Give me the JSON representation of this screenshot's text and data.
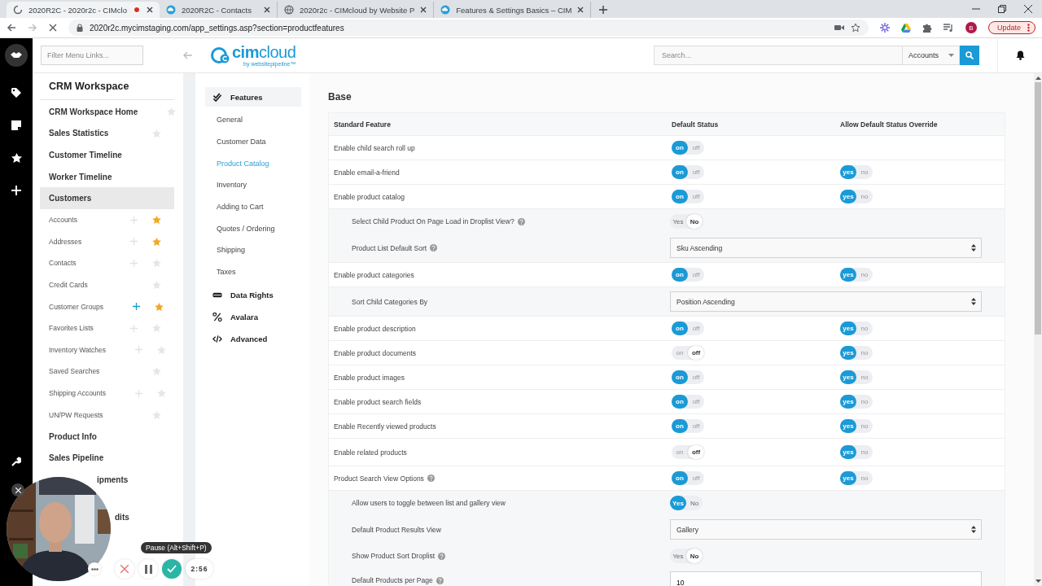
{
  "browser": {
    "tabs": [
      {
        "kind": "loading",
        "title": "2020R2C - 2020r2c - CIMclo",
        "recording": true,
        "selected": true
      },
      {
        "kind": "site",
        "title": "2020R2C - Contacts",
        "recording": false,
        "selected": false
      },
      {
        "kind": "globe",
        "title": "2020r2c - CIMcloud by Website P",
        "recording": false,
        "selected": false
      },
      {
        "kind": "site",
        "title": "Features & Settings Basics – CIM",
        "recording": false,
        "selected": false
      }
    ],
    "url": "2020r2c.mycimstaging.com/app_settings.asp?section=productfeatures",
    "profile": "B",
    "update_button": "Update"
  },
  "header": {
    "filter": {
      "placeholder": "Filter Menu Links..."
    },
    "logo": {
      "name": "**cim**cloud",
      "tagline": "by websitepipeline™"
    },
    "search": {
      "placeholder": "Search..."
    },
    "scope": "Accounts"
  },
  "sidebar": {
    "title": "CRM Workspace",
    "items": [
      {
        "kind": "heading",
        "label": "CRM Workspace Home",
        "selected": false,
        "starred": false
      },
      {
        "kind": "heading",
        "label": "Sales Statistics",
        "selected": false,
        "starred": false
      },
      {
        "kind": "heading",
        "label": "Customer Timeline",
        "selected": false
      },
      {
        "kind": "heading",
        "label": "Worker Timeline",
        "selected": false
      },
      {
        "kind": "heading",
        "label": "Customers",
        "selected": true
      },
      {
        "kind": "sub",
        "label": "Accounts",
        "selected": false,
        "add_active": false,
        "starred": true
      },
      {
        "kind": "sub",
        "label": "Addresses",
        "selected": false,
        "add_active": false,
        "starred": true
      },
      {
        "kind": "sub",
        "label": "Contacts",
        "selected": false,
        "add_active": false,
        "starred": false
      },
      {
        "kind": "sub",
        "label": "Credit Cards",
        "selected": false,
        "starred": false
      },
      {
        "kind": "sub",
        "label": "Customer Groups",
        "selected": false,
        "add_active": true,
        "starred": true
      },
      {
        "kind": "sub",
        "label": "Favorites Lists",
        "selected": false,
        "add_active": false,
        "starred": false
      },
      {
        "kind": "sub",
        "label": "Inventory Watches",
        "selected": false,
        "add_active": false,
        "starred": false
      },
      {
        "kind": "sub",
        "label": "Saved Searches",
        "selected": false,
        "starred": false
      },
      {
        "kind": "sub",
        "label": "Shipping Accounts",
        "selected": false,
        "add_active": false,
        "starred": false
      },
      {
        "kind": "sub",
        "label": "UN/PW Requests",
        "selected": false,
        "starred": false
      },
      {
        "kind": "heading",
        "label": "Product Info",
        "selected": false
      },
      {
        "kind": "heading",
        "label": "Sales Pipeline",
        "selected": false
      },
      {
        "kind": "partial",
        "label": "ipments",
        "selected": false
      },
      {
        "kind": "partial",
        "label": "dits",
        "selected": false
      }
    ]
  },
  "settings_nav": [
    {
      "kind": "group",
      "label": "Features",
      "selected": true,
      "children": [
        {
          "label": "General",
          "selected": false
        },
        {
          "label": "Customer Data",
          "selected": false
        },
        {
          "label": "Product Catalog",
          "selected": true
        },
        {
          "label": "Inventory",
          "selected": false
        },
        {
          "label": "Adding to Cart",
          "selected": false
        },
        {
          "label": "Quotes / Ordering",
          "selected": false
        },
        {
          "label": "Shipping",
          "selected": false
        },
        {
          "label": "Taxes",
          "selected": false
        }
      ]
    },
    {
      "kind": "group",
      "label": "Data Rights",
      "selected": false
    },
    {
      "kind": "group",
      "label": "Avalara",
      "selected": false
    },
    {
      "kind": "group",
      "label": "Advanced",
      "selected": false
    }
  ],
  "page": {
    "title": "Base",
    "table": {
      "columns": [
        "Standard Feature",
        "Default Status",
        "Allow Default Status Override"
      ],
      "rows": [
        {
          "kind": "feature",
          "label": "Enable child search roll up",
          "default": {
            "labels": [
              "on",
              "off"
            ],
            "on": true
          }
        },
        {
          "kind": "feature",
          "label": "Enable email-a-friend",
          "default": {
            "labels": [
              "on",
              "off"
            ],
            "on": true
          },
          "override": {
            "labels": [
              "yes",
              "no"
            ],
            "on": true
          }
        },
        {
          "kind": "feature",
          "label": "Enable product catalog",
          "default": {
            "labels": [
              "on",
              "off"
            ],
            "on": true
          },
          "override": {
            "labels": [
              "yes",
              "no"
            ],
            "on": true
          }
        },
        {
          "kind": "toggle",
          "label": "Select Child Product On Page Load in Droplist View?",
          "help": true,
          "toggle": {
            "labels": [
              "Yes",
              "No"
            ],
            "on": false
          }
        },
        {
          "kind": "select",
          "label": "Product List Default Sort",
          "help": true,
          "value": "Sku Ascending"
        },
        {
          "kind": "feature",
          "label": "Enable product categories",
          "default": {
            "labels": [
              "on",
              "off"
            ],
            "on": true
          },
          "override": {
            "labels": [
              "yes",
              "no"
            ],
            "on": true
          }
        },
        {
          "kind": "select",
          "label": "Sort Child Categories By",
          "help": false,
          "value": "Position Ascending"
        },
        {
          "kind": "feature",
          "label": "Enable product description",
          "default": {
            "labels": [
              "on",
              "off"
            ],
            "on": true
          },
          "override": {
            "labels": [
              "yes",
              "no"
            ],
            "on": true
          }
        },
        {
          "kind": "feature",
          "label": "Enable product documents",
          "default": {
            "labels": [
              "on",
              "off"
            ],
            "on": false
          },
          "override": {
            "labels": [
              "yes",
              "no"
            ],
            "on": true
          }
        },
        {
          "kind": "feature",
          "label": "Enable product images",
          "default": {
            "labels": [
              "on",
              "off"
            ],
            "on": true
          },
          "override": {
            "labels": [
              "yes",
              "no"
            ],
            "on": true
          }
        },
        {
          "kind": "feature",
          "label": "Enable product search fields",
          "default": {
            "labels": [
              "on",
              "off"
            ],
            "on": true
          },
          "override": {
            "labels": [
              "yes",
              "no"
            ],
            "on": true
          }
        },
        {
          "kind": "feature",
          "label": "Enable Recently viewed products",
          "default": {
            "labels": [
              "on",
              "off"
            ],
            "on": true
          },
          "override": {
            "labels": [
              "yes",
              "no"
            ],
            "on": true
          }
        },
        {
          "kind": "feature",
          "label": "Enable related products",
          "default": {
            "labels": [
              "on",
              "off"
            ],
            "on": false
          },
          "override": {
            "labels": [
              "yes",
              "no"
            ],
            "on": true
          }
        },
        {
          "kind": "feature",
          "label": "Product Search View Options",
          "help": true,
          "default": {
            "labels": [
              "on",
              "off"
            ],
            "on": true
          },
          "override": {
            "labels": [
              "yes",
              "no"
            ],
            "on": true
          }
        },
        {
          "kind": "toggle",
          "label": "Allow users to toggle between list and gallery view",
          "help": false,
          "toggle": {
            "labels": [
              "Yes",
              "No"
            ],
            "on": true
          }
        },
        {
          "kind": "select",
          "label": "Default Product Results View",
          "help": false,
          "value": "Gallery"
        },
        {
          "kind": "toggle",
          "label": "Show Product Sort Droplist",
          "help": true,
          "toggle": {
            "labels": [
              "Yes",
              "No"
            ],
            "on": false
          }
        },
        {
          "kind": "input",
          "label": "Default Products per Page",
          "help": true,
          "value": "10"
        }
      ]
    }
  },
  "recorder": {
    "tooltip": "Pause (Alt+Shift+P)",
    "time": "2:56"
  }
}
